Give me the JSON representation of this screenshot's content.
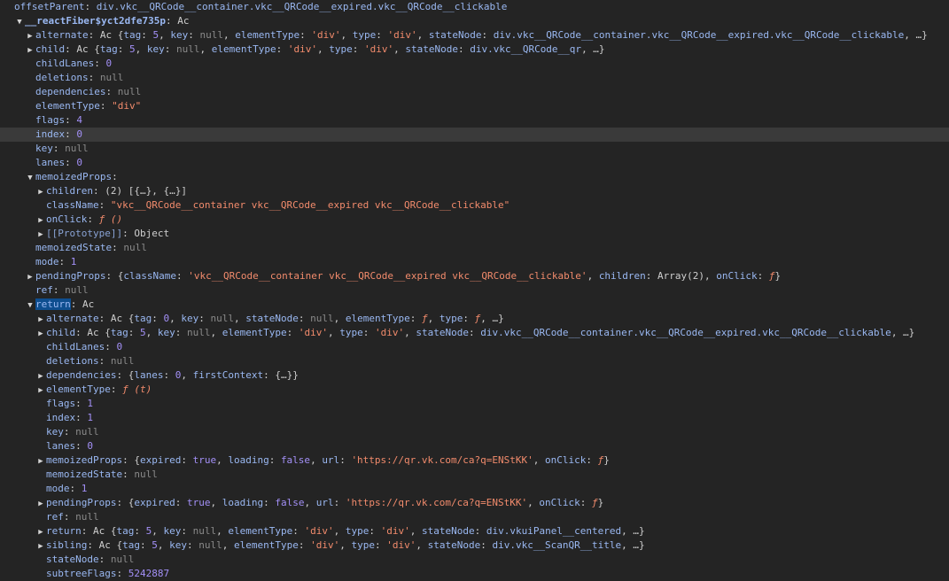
{
  "colors": {
    "background": "#242424",
    "row_highlight": "#3a3a3a",
    "key": "#9ab8f2",
    "number_bool": "#a390f7",
    "string": "#f28b6c",
    "null": "#8a8a8a",
    "selected_key_bg": "#0e4e8f"
  },
  "highlighted_row": 9,
  "selected_key_row": 21,
  "rows": [
    {
      "indent": 0,
      "toggle": "none",
      "tokens": [
        [
          "k",
          "offsetParent"
        ],
        [
          "p",
          ": "
        ],
        [
          "d",
          "div.vkc__QRCode__container.vkc__QRCode__expired.vkc__QRCode__clickable"
        ]
      ]
    },
    {
      "indent": 1,
      "toggle": "down",
      "tokens": [
        [
          "kb",
          "__reactFiber$yct2dfe735p"
        ],
        [
          "p",
          ": Ac"
        ]
      ]
    },
    {
      "indent": 2,
      "toggle": "right",
      "tokens": [
        [
          "k",
          "alternate"
        ],
        [
          "p",
          ": Ac {"
        ],
        [
          "k",
          "tag"
        ],
        [
          "p",
          ": "
        ],
        [
          "n",
          "5"
        ],
        [
          "p",
          ", "
        ],
        [
          "k",
          "key"
        ],
        [
          "p",
          ": "
        ],
        [
          "nl",
          "null"
        ],
        [
          "p",
          ", "
        ],
        [
          "k",
          "elementType"
        ],
        [
          "p",
          ": "
        ],
        [
          "s",
          "'div'"
        ],
        [
          "p",
          ", "
        ],
        [
          "k",
          "type"
        ],
        [
          "p",
          ": "
        ],
        [
          "s",
          "'div'"
        ],
        [
          "p",
          ", "
        ],
        [
          "k",
          "stateNode"
        ],
        [
          "p",
          ": "
        ],
        [
          "d",
          "div.vkc__QRCode__container.vkc__QRCode__expired.vkc__QRCode__clickable"
        ],
        [
          "p",
          ", …}"
        ]
      ]
    },
    {
      "indent": 2,
      "toggle": "right",
      "tokens": [
        [
          "k",
          "child"
        ],
        [
          "p",
          ": Ac {"
        ],
        [
          "k",
          "tag"
        ],
        [
          "p",
          ": "
        ],
        [
          "n",
          "5"
        ],
        [
          "p",
          ", "
        ],
        [
          "k",
          "key"
        ],
        [
          "p",
          ": "
        ],
        [
          "nl",
          "null"
        ],
        [
          "p",
          ", "
        ],
        [
          "k",
          "elementType"
        ],
        [
          "p",
          ": "
        ],
        [
          "s",
          "'div'"
        ],
        [
          "p",
          ", "
        ],
        [
          "k",
          "type"
        ],
        [
          "p",
          ": "
        ],
        [
          "s",
          "'div'"
        ],
        [
          "p",
          ", "
        ],
        [
          "k",
          "stateNode"
        ],
        [
          "p",
          ": "
        ],
        [
          "d",
          "div.vkc__QRCode__qr"
        ],
        [
          "p",
          ", …}"
        ]
      ]
    },
    {
      "indent": 2,
      "toggle": "none",
      "tokens": [
        [
          "k",
          "childLanes"
        ],
        [
          "p",
          ": "
        ],
        [
          "n",
          "0"
        ]
      ]
    },
    {
      "indent": 2,
      "toggle": "none",
      "tokens": [
        [
          "k",
          "deletions"
        ],
        [
          "p",
          ": "
        ],
        [
          "nl",
          "null"
        ]
      ]
    },
    {
      "indent": 2,
      "toggle": "none",
      "tokens": [
        [
          "k",
          "dependencies"
        ],
        [
          "p",
          ": "
        ],
        [
          "nl",
          "null"
        ]
      ]
    },
    {
      "indent": 2,
      "toggle": "none",
      "tokens": [
        [
          "k",
          "elementType"
        ],
        [
          "p",
          ": "
        ],
        [
          "s",
          "\"div\""
        ]
      ]
    },
    {
      "indent": 2,
      "toggle": "none",
      "tokens": [
        [
          "k",
          "flags"
        ],
        [
          "p",
          ": "
        ],
        [
          "n",
          "4"
        ]
      ]
    },
    {
      "indent": 2,
      "toggle": "none",
      "tokens": [
        [
          "k",
          "index"
        ],
        [
          "p",
          ": "
        ],
        [
          "n",
          "0"
        ]
      ]
    },
    {
      "indent": 2,
      "toggle": "none",
      "tokens": [
        [
          "k",
          "key"
        ],
        [
          "p",
          ": "
        ],
        [
          "nl",
          "null"
        ]
      ]
    },
    {
      "indent": 2,
      "toggle": "none",
      "tokens": [
        [
          "k",
          "lanes"
        ],
        [
          "p",
          ": "
        ],
        [
          "n",
          "0"
        ]
      ]
    },
    {
      "indent": 2,
      "toggle": "down",
      "tokens": [
        [
          "k",
          "memoizedProps"
        ],
        [
          "p",
          ":"
        ]
      ]
    },
    {
      "indent": 3,
      "toggle": "right",
      "tokens": [
        [
          "k",
          "children"
        ],
        [
          "p",
          ": (2) [{…}, {…}]"
        ]
      ]
    },
    {
      "indent": 3,
      "toggle": "none",
      "tokens": [
        [
          "k",
          "className"
        ],
        [
          "p",
          ": "
        ],
        [
          "s",
          "\"vkc__QRCode__container vkc__QRCode__expired vkc__QRCode__clickable\""
        ]
      ]
    },
    {
      "indent": 3,
      "toggle": "right",
      "tokens": [
        [
          "k",
          "onClick"
        ],
        [
          "p",
          ": "
        ],
        [
          "f",
          "ƒ ()"
        ]
      ]
    },
    {
      "indent": 3,
      "toggle": "right",
      "tokens": [
        [
          "kp",
          "[[Prototype]]"
        ],
        [
          "p",
          ": Object"
        ]
      ]
    },
    {
      "indent": 2,
      "toggle": "none",
      "tokens": [
        [
          "k",
          "memoizedState"
        ],
        [
          "p",
          ": "
        ],
        [
          "nl",
          "null"
        ]
      ]
    },
    {
      "indent": 2,
      "toggle": "none",
      "tokens": [
        [
          "k",
          "mode"
        ],
        [
          "p",
          ": "
        ],
        [
          "n",
          "1"
        ]
      ]
    },
    {
      "indent": 2,
      "toggle": "right",
      "tokens": [
        [
          "k",
          "pendingProps"
        ],
        [
          "p",
          ": {"
        ],
        [
          "k",
          "className"
        ],
        [
          "p",
          ": "
        ],
        [
          "s",
          "'vkc__QRCode__container vkc__QRCode__expired vkc__QRCode__clickable'"
        ],
        [
          "p",
          ", "
        ],
        [
          "k",
          "children"
        ],
        [
          "p",
          ": Array(2), "
        ],
        [
          "k",
          "onClick"
        ],
        [
          "p",
          ": "
        ],
        [
          "f",
          "ƒ"
        ],
        [
          "p",
          "}"
        ]
      ]
    },
    {
      "indent": 2,
      "toggle": "none",
      "tokens": [
        [
          "k",
          "ref"
        ],
        [
          "p",
          ": "
        ],
        [
          "nl",
          "null"
        ]
      ]
    },
    {
      "indent": 2,
      "toggle": "down",
      "tokens": [
        [
          "ksel",
          "return"
        ],
        [
          "p",
          ": Ac"
        ]
      ]
    },
    {
      "indent": 3,
      "toggle": "right",
      "tokens": [
        [
          "k",
          "alternate"
        ],
        [
          "p",
          ": Ac {"
        ],
        [
          "k",
          "tag"
        ],
        [
          "p",
          ": "
        ],
        [
          "n",
          "0"
        ],
        [
          "p",
          ", "
        ],
        [
          "k",
          "key"
        ],
        [
          "p",
          ": "
        ],
        [
          "nl",
          "null"
        ],
        [
          "p",
          ", "
        ],
        [
          "k",
          "stateNode"
        ],
        [
          "p",
          ": "
        ],
        [
          "nl",
          "null"
        ],
        [
          "p",
          ", "
        ],
        [
          "k",
          "elementType"
        ],
        [
          "p",
          ": "
        ],
        [
          "f",
          "ƒ"
        ],
        [
          "p",
          ", "
        ],
        [
          "k",
          "type"
        ],
        [
          "p",
          ": "
        ],
        [
          "f",
          "ƒ"
        ],
        [
          "p",
          ", …}"
        ]
      ]
    },
    {
      "indent": 3,
      "toggle": "right",
      "tokens": [
        [
          "k",
          "child"
        ],
        [
          "p",
          ": Ac {"
        ],
        [
          "k",
          "tag"
        ],
        [
          "p",
          ": "
        ],
        [
          "n",
          "5"
        ],
        [
          "p",
          ", "
        ],
        [
          "k",
          "key"
        ],
        [
          "p",
          ": "
        ],
        [
          "nl",
          "null"
        ],
        [
          "p",
          ", "
        ],
        [
          "k",
          "elementType"
        ],
        [
          "p",
          ": "
        ],
        [
          "s",
          "'div'"
        ],
        [
          "p",
          ", "
        ],
        [
          "k",
          "type"
        ],
        [
          "p",
          ": "
        ],
        [
          "s",
          "'div'"
        ],
        [
          "p",
          ", "
        ],
        [
          "k",
          "stateNode"
        ],
        [
          "p",
          ": "
        ],
        [
          "d",
          "div.vkc__QRCode__container.vkc__QRCode__expired.vkc__QRCode__clickable"
        ],
        [
          "p",
          ", …}"
        ]
      ]
    },
    {
      "indent": 3,
      "toggle": "none",
      "tokens": [
        [
          "k",
          "childLanes"
        ],
        [
          "p",
          ": "
        ],
        [
          "n",
          "0"
        ]
      ]
    },
    {
      "indent": 3,
      "toggle": "none",
      "tokens": [
        [
          "k",
          "deletions"
        ],
        [
          "p",
          ": "
        ],
        [
          "nl",
          "null"
        ]
      ]
    },
    {
      "indent": 3,
      "toggle": "right",
      "tokens": [
        [
          "k",
          "dependencies"
        ],
        [
          "p",
          ": {"
        ],
        [
          "k",
          "lanes"
        ],
        [
          "p",
          ": "
        ],
        [
          "n",
          "0"
        ],
        [
          "p",
          ", "
        ],
        [
          "k",
          "firstContext"
        ],
        [
          "p",
          ": {…}}"
        ]
      ]
    },
    {
      "indent": 3,
      "toggle": "right",
      "tokens": [
        [
          "k",
          "elementType"
        ],
        [
          "p",
          ": "
        ],
        [
          "f",
          "ƒ (t)"
        ]
      ]
    },
    {
      "indent": 3,
      "toggle": "none",
      "tokens": [
        [
          "k",
          "flags"
        ],
        [
          "p",
          ": "
        ],
        [
          "n",
          "1"
        ]
      ]
    },
    {
      "indent": 3,
      "toggle": "none",
      "tokens": [
        [
          "k",
          "index"
        ],
        [
          "p",
          ": "
        ],
        [
          "n",
          "1"
        ]
      ]
    },
    {
      "indent": 3,
      "toggle": "none",
      "tokens": [
        [
          "k",
          "key"
        ],
        [
          "p",
          ": "
        ],
        [
          "nl",
          "null"
        ]
      ]
    },
    {
      "indent": 3,
      "toggle": "none",
      "tokens": [
        [
          "k",
          "lanes"
        ],
        [
          "p",
          ": "
        ],
        [
          "n",
          "0"
        ]
      ]
    },
    {
      "indent": 3,
      "toggle": "right",
      "tokens": [
        [
          "k",
          "memoizedProps"
        ],
        [
          "p",
          ": {"
        ],
        [
          "k",
          "expired"
        ],
        [
          "p",
          ": "
        ],
        [
          "b",
          "true"
        ],
        [
          "p",
          ", "
        ],
        [
          "k",
          "loading"
        ],
        [
          "p",
          ": "
        ],
        [
          "b",
          "false"
        ],
        [
          "p",
          ", "
        ],
        [
          "k",
          "url"
        ],
        [
          "p",
          ": "
        ],
        [
          "s",
          "'https://qr.vk.com/ca?q=ENStKK'"
        ],
        [
          "p",
          ", "
        ],
        [
          "k",
          "onClick"
        ],
        [
          "p",
          ": "
        ],
        [
          "f",
          "ƒ"
        ],
        [
          "p",
          "}"
        ]
      ]
    },
    {
      "indent": 3,
      "toggle": "none",
      "tokens": [
        [
          "k",
          "memoizedState"
        ],
        [
          "p",
          ": "
        ],
        [
          "nl",
          "null"
        ]
      ]
    },
    {
      "indent": 3,
      "toggle": "none",
      "tokens": [
        [
          "k",
          "mode"
        ],
        [
          "p",
          ": "
        ],
        [
          "n",
          "1"
        ]
      ]
    },
    {
      "indent": 3,
      "toggle": "right",
      "tokens": [
        [
          "k",
          "pendingProps"
        ],
        [
          "p",
          ": {"
        ],
        [
          "k",
          "expired"
        ],
        [
          "p",
          ": "
        ],
        [
          "b",
          "true"
        ],
        [
          "p",
          ", "
        ],
        [
          "k",
          "loading"
        ],
        [
          "p",
          ": "
        ],
        [
          "b",
          "false"
        ],
        [
          "p",
          ", "
        ],
        [
          "k",
          "url"
        ],
        [
          "p",
          ": "
        ],
        [
          "s",
          "'https://qr.vk.com/ca?q=ENStKK'"
        ],
        [
          "p",
          ", "
        ],
        [
          "k",
          "onClick"
        ],
        [
          "p",
          ": "
        ],
        [
          "f",
          "ƒ"
        ],
        [
          "p",
          "}"
        ]
      ]
    },
    {
      "indent": 3,
      "toggle": "none",
      "tokens": [
        [
          "k",
          "ref"
        ],
        [
          "p",
          ": "
        ],
        [
          "nl",
          "null"
        ]
      ]
    },
    {
      "indent": 3,
      "toggle": "right",
      "tokens": [
        [
          "k",
          "return"
        ],
        [
          "p",
          ": Ac {"
        ],
        [
          "k",
          "tag"
        ],
        [
          "p",
          ": "
        ],
        [
          "n",
          "5"
        ],
        [
          "p",
          ", "
        ],
        [
          "k",
          "key"
        ],
        [
          "p",
          ": "
        ],
        [
          "nl",
          "null"
        ],
        [
          "p",
          ", "
        ],
        [
          "k",
          "elementType"
        ],
        [
          "p",
          ": "
        ],
        [
          "s",
          "'div'"
        ],
        [
          "p",
          ", "
        ],
        [
          "k",
          "type"
        ],
        [
          "p",
          ": "
        ],
        [
          "s",
          "'div'"
        ],
        [
          "p",
          ", "
        ],
        [
          "k",
          "stateNode"
        ],
        [
          "p",
          ": "
        ],
        [
          "d",
          "div.vkuiPanel__centered"
        ],
        [
          "p",
          ", …}"
        ]
      ]
    },
    {
      "indent": 3,
      "toggle": "right",
      "tokens": [
        [
          "k",
          "sibling"
        ],
        [
          "p",
          ": Ac {"
        ],
        [
          "k",
          "tag"
        ],
        [
          "p",
          ": "
        ],
        [
          "n",
          "5"
        ],
        [
          "p",
          ", "
        ],
        [
          "k",
          "key"
        ],
        [
          "p",
          ": "
        ],
        [
          "nl",
          "null"
        ],
        [
          "p",
          ", "
        ],
        [
          "k",
          "elementType"
        ],
        [
          "p",
          ": "
        ],
        [
          "s",
          "'div'"
        ],
        [
          "p",
          ", "
        ],
        [
          "k",
          "type"
        ],
        [
          "p",
          ": "
        ],
        [
          "s",
          "'div'"
        ],
        [
          "p",
          ", "
        ],
        [
          "k",
          "stateNode"
        ],
        [
          "p",
          ": "
        ],
        [
          "d",
          "div.vkc__ScanQR__title"
        ],
        [
          "p",
          ", …}"
        ]
      ]
    },
    {
      "indent": 3,
      "toggle": "none",
      "tokens": [
        [
          "k",
          "stateNode"
        ],
        [
          "p",
          ": "
        ],
        [
          "nl",
          "null"
        ]
      ]
    },
    {
      "indent": 3,
      "toggle": "none",
      "tokens": [
        [
          "k",
          "subtreeFlags"
        ],
        [
          "p",
          ": "
        ],
        [
          "n",
          "5242887"
        ]
      ]
    }
  ]
}
